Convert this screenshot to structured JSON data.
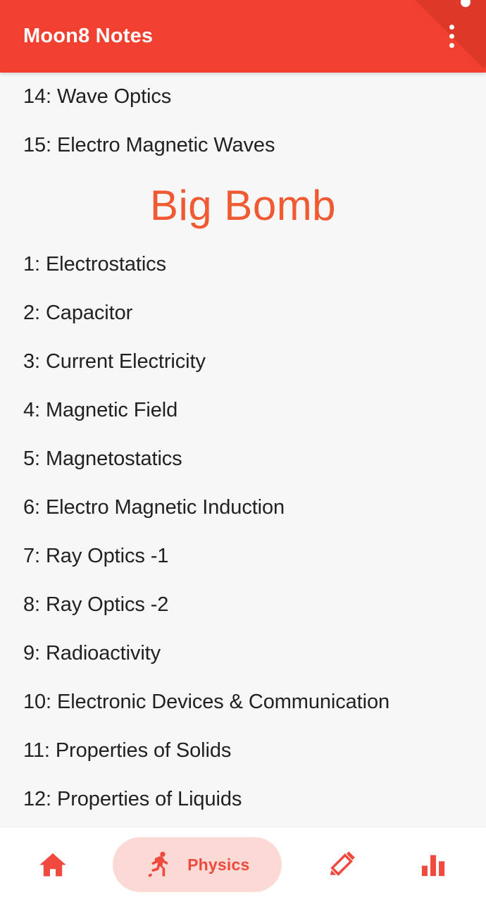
{
  "app": {
    "title": "Moon8 Notes",
    "accent_color": "#f1402f",
    "accent_dark_color": "#dd3828",
    "content_bg_color": "#f7f7f7",
    "heading_color": "#f05a32",
    "nav_icon_color": "#ef4a3d",
    "nav_selected_pill_color": "#fbd9d5"
  },
  "appbar": {
    "title": "Moon8 Notes",
    "overflow_menu_icon": "more-vertical-icon",
    "corner_ribbon_icon": "corner-ribbon"
  },
  "content": {
    "items_before_heading": [
      {
        "label": "14: Wave Optics"
      },
      {
        "label": "15: Electro Magnetic Waves"
      }
    ],
    "heading": "Big Bomb",
    "items_after_heading": [
      {
        "label": "1: Electrostatics"
      },
      {
        "label": "2: Capacitor"
      },
      {
        "label": "3: Current Electricity"
      },
      {
        "label": "4: Magnetic Field"
      },
      {
        "label": "5: Magnetostatics"
      },
      {
        "label": "6: Electro Magnetic Induction"
      },
      {
        "label": "7: Ray Optics -1"
      },
      {
        "label": "8: Ray Optics -2"
      },
      {
        "label": "9: Radioactivity"
      },
      {
        "label": "10: Electronic Devices & Communication"
      },
      {
        "label": "11: Properties of Solids"
      },
      {
        "label": "12: Properties of Liquids"
      }
    ]
  },
  "bottom_nav": {
    "items": [
      {
        "icon": "home-icon",
        "label": "",
        "selected": false
      },
      {
        "icon": "running-person-icon",
        "label": "Physics",
        "selected": true
      },
      {
        "icon": "pencil-icon",
        "label": "",
        "selected": false
      },
      {
        "icon": "bar-chart-icon",
        "label": "",
        "selected": false
      }
    ]
  }
}
